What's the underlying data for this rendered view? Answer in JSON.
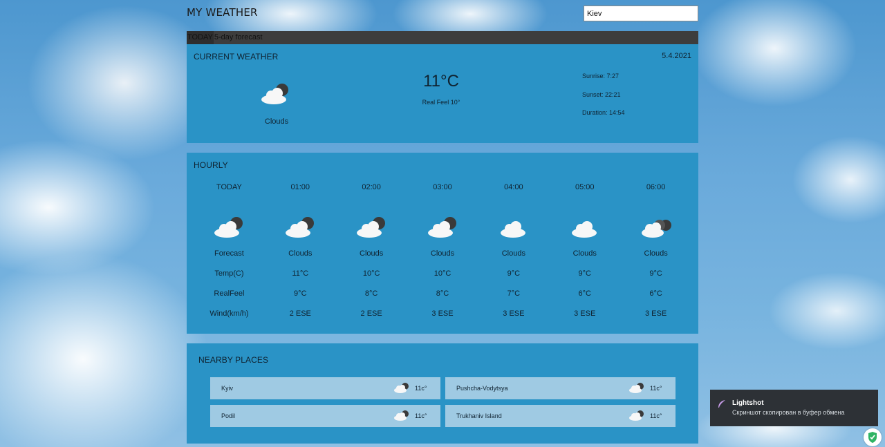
{
  "header": {
    "title": "MY WEATHER"
  },
  "search": {
    "value": "Kiev"
  },
  "tabs": [
    {
      "label": "TODAY",
      "active": true
    },
    {
      "label": "5-day forecast",
      "active": false
    }
  ],
  "current": {
    "title": "CURRENT WEATHER",
    "date": "5.4.2021",
    "icon": "cloud-sun-icon",
    "description": "Clouds",
    "temperature": "11°C",
    "real_feel": "Real Feel 10°",
    "sunrise": "Sunrise: 7:27",
    "sunset": "Sunset: 22:21",
    "duration": "Duration: 14:54"
  },
  "hourly": {
    "title": "HOURLY",
    "label_column": {
      "time": "TODAY",
      "forecast": "Forecast",
      "temp": "Temp(C)",
      "realfeel": "RealFeel",
      "wind": "Wind(km/h)"
    },
    "hours": [
      {
        "time": "01:00",
        "icon": "cloud-night-icon",
        "forecast": "Clouds",
        "temp": "11°C",
        "realfeel": "9°C",
        "wind": "2 ESE"
      },
      {
        "time": "02:00",
        "icon": "cloud-night-icon",
        "forecast": "Clouds",
        "temp": "10°C",
        "realfeel": "8°C",
        "wind": "2 ESE"
      },
      {
        "time": "03:00",
        "icon": "cloud-night-icon",
        "forecast": "Clouds",
        "temp": "10°C",
        "realfeel": "8°C",
        "wind": "3 ESE"
      },
      {
        "time": "04:00",
        "icon": "cloud-icon",
        "forecast": "Clouds",
        "temp": "9°C",
        "realfeel": "7°C",
        "wind": "3 ESE"
      },
      {
        "time": "05:00",
        "icon": "cloud-icon",
        "forecast": "Clouds",
        "temp": "9°C",
        "realfeel": "6°C",
        "wind": "3 ESE"
      },
      {
        "time": "06:00",
        "icon": "broken-clouds-icon",
        "forecast": "Clouds",
        "temp": "9°C",
        "realfeel": "6°C",
        "wind": "3 ESE"
      }
    ]
  },
  "nearby": {
    "title": "NEARBY PLACES",
    "places": [
      {
        "name": "Kyiv",
        "temp": "11c°"
      },
      {
        "name": "Pushcha-Vodytsya",
        "temp": "11c°"
      },
      {
        "name": "Podil",
        "temp": "11c°"
      },
      {
        "name": "Trukhaniv Island",
        "temp": "11c°"
      }
    ]
  },
  "toast": {
    "app": "Lightshot",
    "message": "Скриншот скопирован в буфер обмена"
  },
  "colors": {
    "panel": "#2a93c6",
    "tab_bar": "#3d3d3d",
    "place_card": "#9fcae3",
    "toast_bg": "#2d3136"
  }
}
